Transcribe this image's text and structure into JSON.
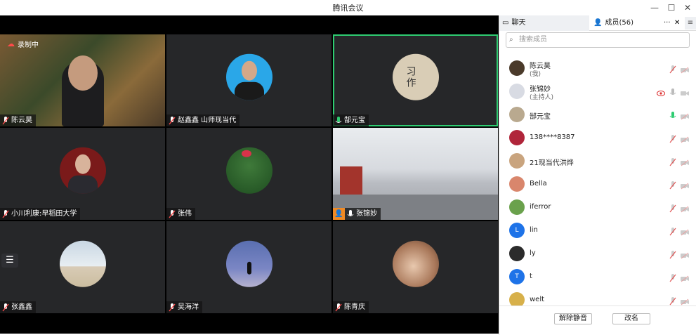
{
  "window": {
    "title": "腾讯会议",
    "min": "—",
    "max": "☐",
    "close": "✕"
  },
  "recording": {
    "label": "录制中"
  },
  "tiles": [
    {
      "name": "陈云昊",
      "mic": "muted"
    },
    {
      "name": "赵鑫鑫 山师现当代",
      "mic": "muted"
    },
    {
      "name": "郜元宝",
      "mic": "on"
    },
    {
      "name": "小川利康:早稻田大学",
      "mic": "muted"
    },
    {
      "name": "张伟",
      "mic": "muted"
    },
    {
      "name": "张锦妙",
      "mic": "on"
    },
    {
      "name": "张鑫鑫",
      "mic": "muted"
    },
    {
      "name": "吴海洋",
      "mic": "muted"
    },
    {
      "name": "陈青庆",
      "mic": "muted"
    }
  ],
  "panel": {
    "tab_chat": "聊天",
    "tab_members": "成员(56)",
    "more": "···",
    "close": "✕",
    "menu": "≡",
    "search_placeholder": "搜索成员",
    "members": [
      {
        "name": "陈云昊",
        "sub": "(我)",
        "mic": "muted",
        "avatar_color": "#4a3a2a",
        "avatar_text": ""
      },
      {
        "name": "张锦妙",
        "sub": "(主持人)",
        "mic": "off-gray",
        "avatar_color": "#d8dbe3",
        "avatar_text": ""
      },
      {
        "name": "郜元宝",
        "sub": "",
        "mic": "on",
        "avatar_color": "#b9a98f",
        "avatar_text": ""
      },
      {
        "name": "138****8387",
        "sub": "",
        "mic": "muted",
        "avatar_color": "#b0253a",
        "avatar_text": ""
      },
      {
        "name": "21现当代洪烨",
        "sub": "",
        "mic": "muted",
        "avatar_color": "#c9a47e",
        "avatar_text": ""
      },
      {
        "name": "Bella",
        "sub": "",
        "mic": "muted",
        "avatar_color": "#d9866c",
        "avatar_text": ""
      },
      {
        "name": "iferror",
        "sub": "",
        "mic": "muted",
        "avatar_color": "#6aa14c",
        "avatar_text": ""
      },
      {
        "name": "lin",
        "sub": "",
        "mic": "muted",
        "avatar_color": "#1e73e8",
        "avatar_text": "L"
      },
      {
        "name": "ly",
        "sub": "",
        "mic": "muted",
        "avatar_color": "#2b2b2b",
        "avatar_text": ""
      },
      {
        "name": "t",
        "sub": "",
        "mic": "muted",
        "avatar_color": "#1e73e8",
        "avatar_text": "T"
      },
      {
        "name": "welt",
        "sub": "",
        "mic": "muted",
        "avatar_color": "#d7b04a",
        "avatar_text": ""
      }
    ],
    "unmute_button": "解除静音",
    "rename_button": "改名"
  }
}
